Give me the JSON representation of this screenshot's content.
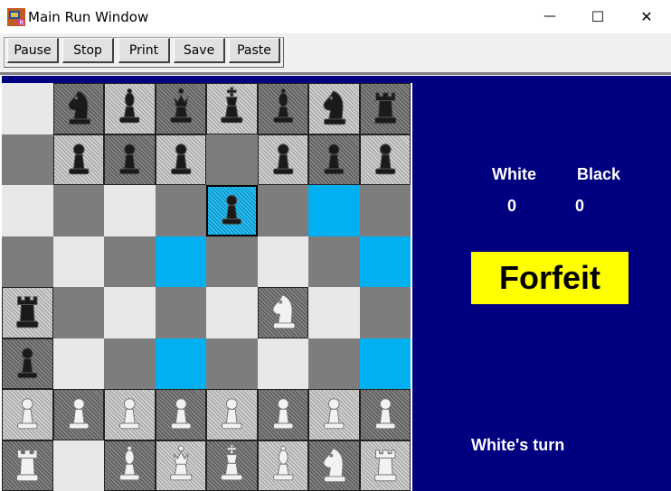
{
  "window": {
    "title": "Main Run Window",
    "minimize_glyph": "—",
    "maximize_glyph": "☐",
    "close_glyph": "✕"
  },
  "toolbar": {
    "pause": "Pause",
    "stop": "Stop",
    "print": "Print",
    "save": "Save",
    "paste": "Paste"
  },
  "score": {
    "white_label": "White",
    "black_label": "Black",
    "white_value": "0",
    "black_value": "0"
  },
  "forfeit_label": "Forfeit",
  "turn_text": "White's turn",
  "colors": {
    "panel": "#000080",
    "highlight": "#00b0f0",
    "forfeit_bg": "#ffff00",
    "light_square": "#e8e8e8",
    "dark_square": "#7d7d7d"
  },
  "board": [
    [
      null,
      {
        "c": "b",
        "p": "knight"
      },
      {
        "c": "b",
        "p": "bishop"
      },
      {
        "c": "b",
        "p": "queen"
      },
      {
        "c": "b",
        "p": "king"
      },
      {
        "c": "b",
        "p": "bishop"
      },
      {
        "c": "b",
        "p": "knight"
      },
      {
        "c": "b",
        "p": "rook"
      }
    ],
    [
      null,
      {
        "c": "b",
        "p": "pawn"
      },
      {
        "c": "b",
        "p": "pawn"
      },
      {
        "c": "b",
        "p": "pawn"
      },
      null,
      {
        "c": "b",
        "p": "pawn"
      },
      {
        "c": "b",
        "p": "pawn"
      },
      {
        "c": "b",
        "p": "pawn"
      }
    ],
    [
      null,
      null,
      null,
      null,
      {
        "c": "b",
        "p": "pawn",
        "sel": true
      },
      null,
      "hl",
      null
    ],
    [
      null,
      null,
      null,
      "hl",
      null,
      null,
      null,
      "hl"
    ],
    [
      {
        "c": "b",
        "p": "rook"
      },
      null,
      null,
      null,
      null,
      {
        "c": "w",
        "p": "knight"
      },
      null,
      null
    ],
    [
      {
        "c": "b",
        "p": "pawn"
      },
      null,
      null,
      "hl",
      null,
      null,
      null,
      "hl"
    ],
    [
      {
        "c": "w",
        "p": "pawn"
      },
      {
        "c": "w",
        "p": "pawn"
      },
      {
        "c": "w",
        "p": "pawn"
      },
      {
        "c": "w",
        "p": "pawn"
      },
      {
        "c": "w",
        "p": "pawn"
      },
      {
        "c": "w",
        "p": "pawn"
      },
      {
        "c": "w",
        "p": "pawn"
      },
      {
        "c": "w",
        "p": "pawn"
      }
    ],
    [
      {
        "c": "w",
        "p": "rook"
      },
      null,
      {
        "c": "w",
        "p": "bishop"
      },
      {
        "c": "w",
        "p": "queen"
      },
      {
        "c": "w",
        "p": "king"
      },
      {
        "c": "w",
        "p": "bishop"
      },
      {
        "c": "w",
        "p": "knight"
      },
      {
        "c": "w",
        "p": "rook"
      }
    ]
  ]
}
